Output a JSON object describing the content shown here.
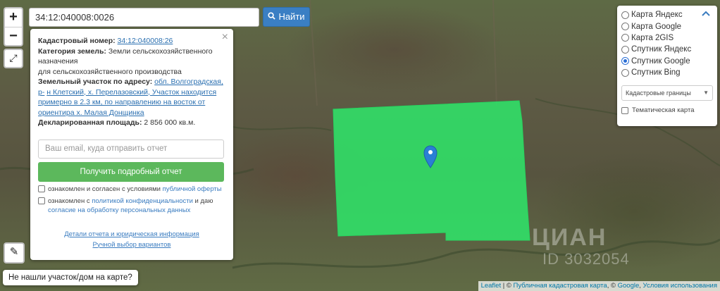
{
  "search": {
    "value": "34:12:040008:0026",
    "button_label": "Найти",
    "button_icon": "search-icon"
  },
  "zoom": {
    "in_label": "+",
    "out_label": "−"
  },
  "map_controls": {
    "fullscreen_icon": "expand-icon",
    "ruler_icon": "ruler-icon"
  },
  "card": {
    "close_label": "×",
    "cadastral_label": "Кадастровый номер:",
    "cadastral_value": "34:12:040008:26",
    "category_label": "Категория земель:",
    "category_value": "Земли сельскохозяйственного назначения",
    "category_value_line2": "для сельскохозяйственного производства",
    "address_label": "Земельный участок по адресу:",
    "address_value_lead": "обл. Волгоградская, р-",
    "address_value_rest": "н Клетский, х. Перелазовский, Участок находится примерно в 2.3 км, по направлению на восток от ориентира х. Малая Донщинка",
    "area_label": "Декларированная площадь:",
    "area_value": "2 856 000 кв.м.",
    "email_placeholder": "Ваш email, куда отправить отчет",
    "report_button": "Получить подробный отчет",
    "consent1_text": "ознакомлен и согласен с условиями ",
    "consent1_link": "публичной оферты",
    "consent2_text": "ознакомлен с ",
    "consent2_link": "политикой конфиденциальности",
    "consent2_mid": " и даю ",
    "consent2_link2": "согласие на обработку персональных данных",
    "link_details": "Детали отчета и юридическая информация",
    "link_manual": "Ручной выбор вариантов"
  },
  "notfound": "Не нашли участок/дом на карте?",
  "layers": {
    "collapse_icon": "chevron-up-icon",
    "options": [
      {
        "label": "Карта Яндекс",
        "selected": false
      },
      {
        "label": "Карта Google",
        "selected": false
      },
      {
        "label": "Карта 2GIS",
        "selected": false
      },
      {
        "label": "Спутник Яндекс",
        "selected": false
      },
      {
        "label": "Спутник Google",
        "selected": true
      },
      {
        "label": "Спутник Bing",
        "selected": false
      }
    ],
    "overlay_select": "Кадастровые границы",
    "thematic_label": "Тематическая карта"
  },
  "attribution": {
    "leaflet": "Leaflet",
    "sep1": " | © ",
    "pkk": "Публичная кадастровая карта",
    "sep2": ", © ",
    "google": "Google",
    "sep3": ", ",
    "terms": "Условия использования"
  },
  "watermark": {
    "brand": "ЦИАН",
    "id": "ID 3032054"
  },
  "colors": {
    "parcel": "#2ee86a",
    "accent": "#3a7fc4",
    "button_green": "#5cb85c",
    "marker": "#2a7fd4"
  }
}
